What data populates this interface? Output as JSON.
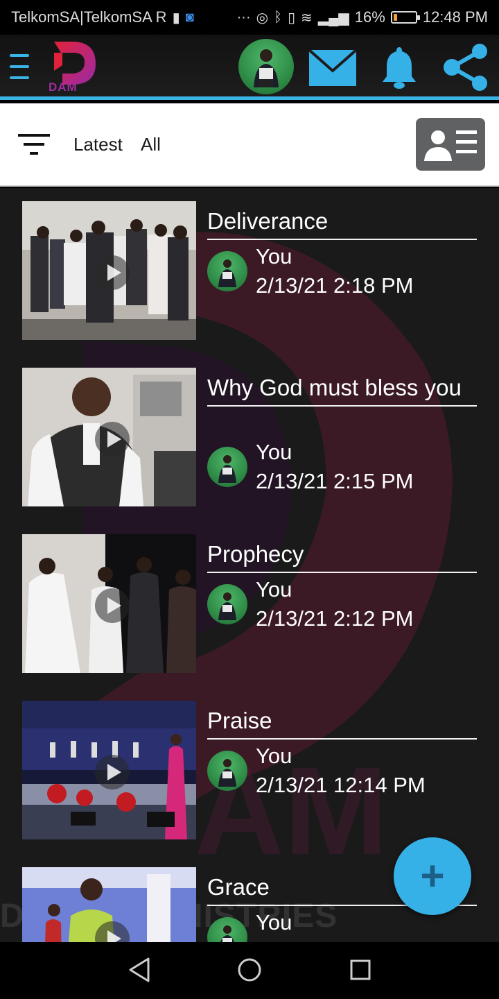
{
  "status_bar": {
    "carrier": "TelkomSA|TelkomSA R",
    "battery_pct": "16%",
    "battery_level": 0.16,
    "time": "12:48 PM",
    "icons": [
      "sim-icon",
      "app-icon",
      "more-dots-icon",
      "data-saver-icon",
      "bluetooth-icon",
      "vibrate-icon",
      "wifi-icon",
      "signal-icon",
      "battery-icon"
    ]
  },
  "header": {
    "logo_text": "DAM",
    "icons": [
      "menu-icon",
      "profile-avatar",
      "mail-icon",
      "bell-icon",
      "share-icon"
    ]
  },
  "filter": {
    "tabs": [
      "Latest",
      "All"
    ]
  },
  "items": [
    {
      "title": "Deliverance",
      "author": "You",
      "date": "2/13/21 2:18 PM"
    },
    {
      "title": "Why God must bless you",
      "author": "You",
      "date": "2/13/21 2:15 PM"
    },
    {
      "title": "Prophecy",
      "author": "You",
      "date": "2/13/21 2:12 PM"
    },
    {
      "title": "Praise",
      "author": "You",
      "date": "2/13/21 12:14 PM"
    },
    {
      "title": "Grace",
      "author": "You",
      "date": ""
    }
  ],
  "watermark": "DA          BUE MINISTRIES",
  "fab": {
    "label": "+"
  },
  "colors": {
    "accent": "#35b1e8",
    "brand": "#a12da0",
    "background": "#1a1a1a"
  }
}
